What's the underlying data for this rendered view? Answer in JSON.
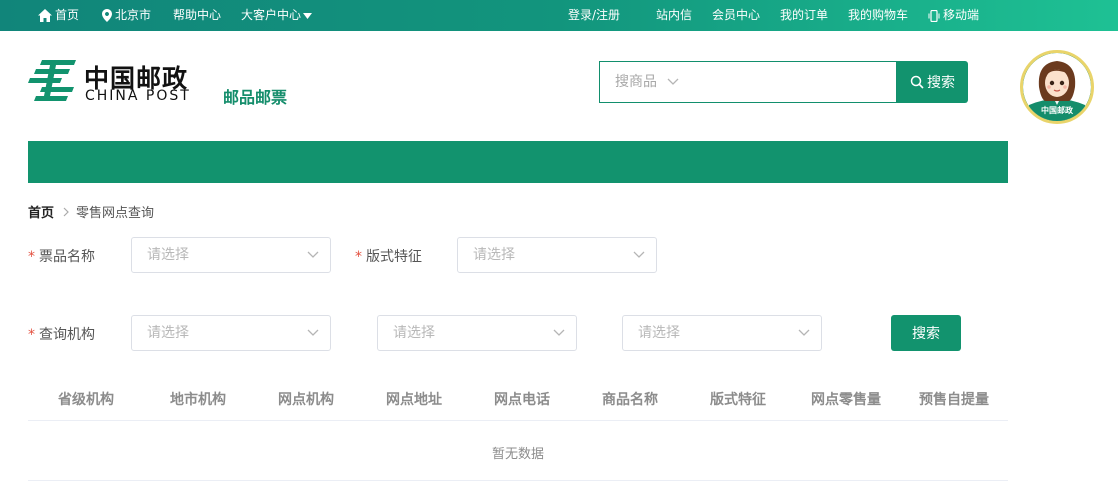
{
  "topbar": {
    "home": "首页",
    "location": "北京市",
    "help": "帮助中心",
    "enterprise": "大客户中心",
    "login": "登录/注册",
    "inbox": "站内信",
    "member": "会员中心",
    "orders": "我的订单",
    "cart": "我的购物车",
    "mobile": "移动端"
  },
  "header": {
    "logo_cn": "中国邮政",
    "logo_en": "CHINA POST",
    "sub_title": "邮品邮票",
    "search_placeholder": "搜商品",
    "search_button": "搜索",
    "avatar_text": "中国邮政"
  },
  "breadcrumb": {
    "home": "首页",
    "current": "零售网点查询"
  },
  "form": {
    "product_name_label": "票品名称",
    "format_label": "版式特征",
    "org_label": "查询机构",
    "placeholder": "请选择",
    "query_button": "搜索"
  },
  "table": {
    "headers": [
      "省级机构",
      "地市机构",
      "网点机构",
      "网点地址",
      "网点电话",
      "商品名称",
      "版式特征",
      "网点零售量",
      "预售自提量"
    ],
    "empty_text": "暂无数据"
  },
  "colors": {
    "brand_green": "#12936e",
    "required_star": "#e3503f"
  }
}
